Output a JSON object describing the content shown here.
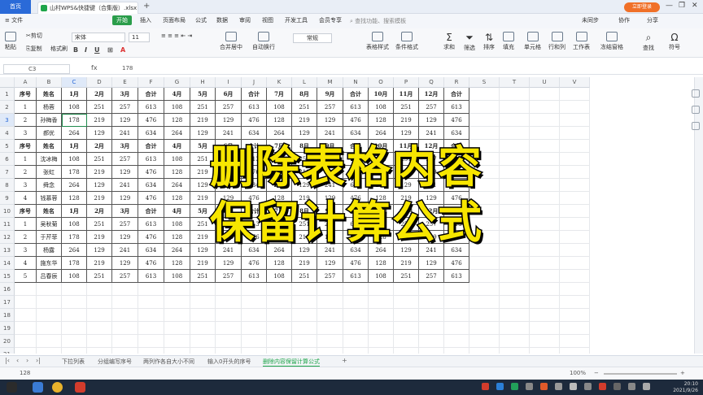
{
  "titlebar": {
    "home_label": "首页",
    "doc_title": "山村WPS&快捷键（合集版）.xlsx",
    "login_label": "立即登录",
    "controls": [
      "—",
      "❐",
      "✕"
    ]
  },
  "menu": {
    "items": [
      "≡ 文件",
      "开始",
      "插入",
      "页面布局",
      "公式",
      "数据",
      "审阅",
      "视图",
      "开发工具",
      "会员专享"
    ],
    "active_index": 1,
    "search_placeholder": "查找功能、搜索模板",
    "right_items": [
      "未同步",
      "协作",
      "分享"
    ]
  },
  "ribbon": {
    "cut": "剪切",
    "paste": "粘贴",
    "copy": "复制",
    "format_painter": "格式刷",
    "font_name": "宋体",
    "font_size": "11",
    "merge": "合并居中",
    "wrap": "自动换行",
    "number_format": "常规",
    "cond_format": "条件格式",
    "cell_style": "表格样式",
    "sum": "求和",
    "filter": "筛选",
    "sort": "排序",
    "fill": "填充",
    "cell": "单元格",
    "row_col": "行和列",
    "worksheet": "工作表",
    "freeze": "冻结窗格",
    "find": "查找",
    "symbol": "符号"
  },
  "formula_bar": {
    "cell_ref": "C3",
    "fx": "fx",
    "value": "178"
  },
  "columns": [
    "A",
    "B",
    "C",
    "D",
    "E",
    "F",
    "G",
    "H",
    "I",
    "J",
    "K",
    "L",
    "M",
    "N",
    "O",
    "P",
    "Q",
    "R",
    "S",
    "T",
    "U",
    "V",
    "W"
  ],
  "rows": [
    "1",
    "2",
    "3",
    "4",
    "5",
    "6",
    "7",
    "8",
    "9",
    "10",
    "11",
    "12",
    "13",
    "14",
    "15",
    "16",
    "17",
    "18",
    "19",
    "20",
    "21"
  ],
  "table": [
    [
      "序号",
      "姓名",
      "1月",
      "2月",
      "3月",
      "合计",
      "4月",
      "5月",
      "6月",
      "合计",
      "7月",
      "8月",
      "9月",
      "合计",
      "10月",
      "11月",
      "12月",
      "合计"
    ],
    [
      "1",
      "杨蓉",
      "108",
      "251",
      "257",
      "613",
      "108",
      "251",
      "257",
      "613",
      "108",
      "251",
      "257",
      "613",
      "108",
      "251",
      "257",
      "613"
    ],
    [
      "2",
      "孙梅香",
      "178",
      "219",
      "129",
      "476",
      "128",
      "219",
      "129",
      "476",
      "128",
      "219",
      "129",
      "476",
      "128",
      "219",
      "129",
      "476"
    ],
    [
      "3",
      "郝优",
      "264",
      "129",
      "241",
      "634",
      "264",
      "129",
      "241",
      "634",
      "264",
      "129",
      "241",
      "634",
      "264",
      "129",
      "241",
      "634"
    ],
    [
      "序号",
      "姓名",
      "1月",
      "2月",
      "3月",
      "合计",
      "4月",
      "5月",
      "6月",
      "合计",
      "7月",
      "8月",
      "9月",
      "合计",
      "10月",
      "11月",
      "12月",
      "合计"
    ],
    [
      "1",
      "沈冰梅",
      "108",
      "251",
      "257",
      "613",
      "108",
      "251",
      "257",
      "613",
      "108",
      "251",
      "257",
      "613",
      "108",
      "251",
      "257",
      "613"
    ],
    [
      "2",
      "张虹",
      "178",
      "219",
      "129",
      "476",
      "128",
      "219",
      "129",
      "476",
      "128",
      "219",
      "129",
      "476",
      "128",
      "219",
      "129",
      "476"
    ],
    [
      "3",
      "舜念",
      "264",
      "129",
      "241",
      "634",
      "264",
      "129",
      "241",
      "634",
      "264",
      "129",
      "241",
      "634",
      "264",
      "129",
      "241",
      "634"
    ],
    [
      "4",
      "钱慕蓉",
      "128",
      "219",
      "129",
      "476",
      "128",
      "219",
      "129",
      "476",
      "128",
      "219",
      "129",
      "476",
      "128",
      "219",
      "129",
      "476"
    ],
    [
      "序号",
      "姓名",
      "1月",
      "2月",
      "3月",
      "合计",
      "4月",
      "5月",
      "6月",
      "合计",
      "7月",
      "8月",
      "9月",
      "合计",
      "10月",
      "11月",
      "12月",
      "合计"
    ],
    [
      "1",
      "吴秋菊",
      "108",
      "251",
      "257",
      "613",
      "108",
      "251",
      "257",
      "613",
      "108",
      "251",
      "257",
      "613",
      "108",
      "251",
      "257",
      "613"
    ],
    [
      "2",
      "于芹菲",
      "178",
      "219",
      "129",
      "476",
      "128",
      "219",
      "129",
      "476",
      "128",
      "219",
      "129",
      "476",
      "128",
      "219",
      "129",
      "476"
    ],
    [
      "3",
      "杨露",
      "264",
      "129",
      "241",
      "634",
      "264",
      "129",
      "241",
      "634",
      "264",
      "129",
      "241",
      "634",
      "264",
      "129",
      "241",
      "634"
    ],
    [
      "4",
      "施东华",
      "178",
      "219",
      "129",
      "476",
      "128",
      "219",
      "129",
      "476",
      "128",
      "219",
      "129",
      "476",
      "128",
      "219",
      "129",
      "476"
    ],
    [
      "5",
      "吕春辰",
      "108",
      "251",
      "257",
      "613",
      "108",
      "251",
      "257",
      "613",
      "108",
      "251",
      "257",
      "613",
      "108",
      "251",
      "257",
      "613"
    ]
  ],
  "overlay": {
    "line1": "删除表格内容",
    "line2": "保留计算公式"
  },
  "sheets": [
    "下拉列表",
    "分组编写序号",
    "两列作各自大小不同",
    "输入0开头的序号",
    "删除内容保留计算公式"
  ],
  "active_sheet_index": 4,
  "status": {
    "value_text": "128",
    "zoom": "100%"
  },
  "taskbar": {
    "time": "20:10",
    "date": "2021/9/26"
  }
}
